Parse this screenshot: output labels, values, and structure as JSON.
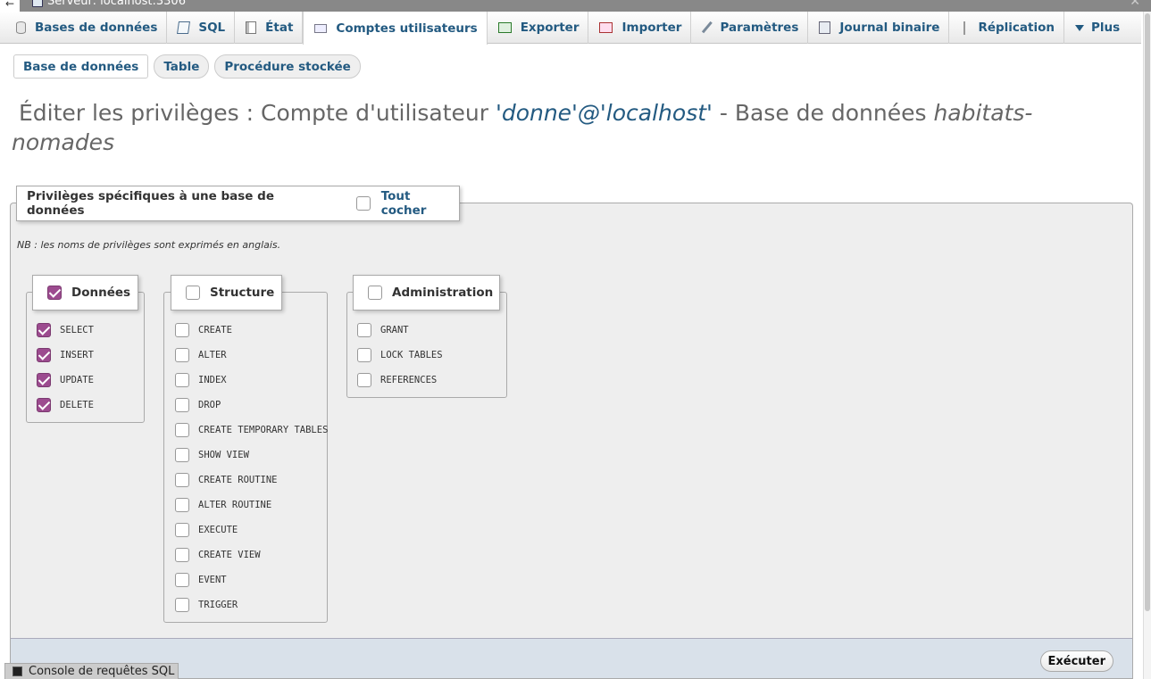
{
  "window": {
    "title": "Serveur: localhost:3306",
    "back_glyph": "←",
    "close_glyph": "✕"
  },
  "tabs": [
    {
      "label": "Bases de données",
      "icon": "database-icon"
    },
    {
      "label": "SQL",
      "icon": "sql-icon"
    },
    {
      "label": "État",
      "icon": "status-icon"
    },
    {
      "label": "Comptes utilisateurs",
      "icon": "users-icon",
      "active": true
    },
    {
      "label": "Exporter",
      "icon": "export-icon"
    },
    {
      "label": "Importer",
      "icon": "import-icon"
    },
    {
      "label": "Paramètres",
      "icon": "wrench-icon"
    },
    {
      "label": "Journal binaire",
      "icon": "binary-log-icon"
    },
    {
      "label": "Réplication",
      "icon": "replication-icon"
    },
    {
      "label": "Plus",
      "icon": "triangle-down-icon"
    }
  ],
  "subtabs": [
    {
      "label": "Base de données",
      "active": true
    },
    {
      "label": "Table"
    },
    {
      "label": "Procédure stockée"
    }
  ],
  "heading": {
    "prefix": "Éditer les privilèges : Compte d'utilisateur ",
    "account": "'donne'@'localhost'",
    "middle": " - Base de données ",
    "database": "habitats-nomades"
  },
  "privileges_panel": {
    "legend": "Privilèges spécifiques à une base de données",
    "check_all_label": "Tout cocher",
    "check_all_checked": false,
    "note": "NB : les noms de privilèges sont exprimés en anglais."
  },
  "groups": {
    "data": {
      "label": "Données",
      "checked": true,
      "items": [
        {
          "label": "SELECT",
          "checked": true
        },
        {
          "label": "INSERT",
          "checked": true
        },
        {
          "label": "UPDATE",
          "checked": true
        },
        {
          "label": "DELETE",
          "checked": true
        }
      ]
    },
    "structure": {
      "label": "Structure",
      "checked": false,
      "items": [
        {
          "label": "CREATE",
          "checked": false
        },
        {
          "label": "ALTER",
          "checked": false
        },
        {
          "label": "INDEX",
          "checked": false
        },
        {
          "label": "DROP",
          "checked": false
        },
        {
          "label": "CREATE TEMPORARY TABLES",
          "checked": false
        },
        {
          "label": "SHOW VIEW",
          "checked": false
        },
        {
          "label": "CREATE ROUTINE",
          "checked": false
        },
        {
          "label": "ALTER ROUTINE",
          "checked": false
        },
        {
          "label": "EXECUTE",
          "checked": false
        },
        {
          "label": "CREATE VIEW",
          "checked": false
        },
        {
          "label": "EVENT",
          "checked": false
        },
        {
          "label": "TRIGGER",
          "checked": false
        }
      ]
    },
    "admin": {
      "label": "Administration",
      "checked": false,
      "items": [
        {
          "label": "GRANT",
          "checked": false
        },
        {
          "label": "LOCK TABLES",
          "checked": false
        },
        {
          "label": "REFERENCES",
          "checked": false
        }
      ]
    }
  },
  "footer": {
    "execute_label": "Exécuter",
    "console_label": "Console de requêtes SQL"
  },
  "colors": {
    "link": "#235a81",
    "checkbox_checked": "#9c4b8f",
    "panel_bg": "#eeeeee",
    "footer_bg": "#d9e1ea"
  }
}
